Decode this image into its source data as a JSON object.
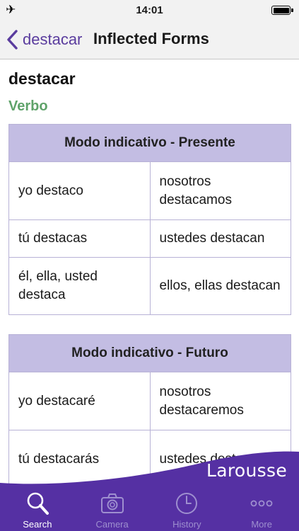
{
  "status_bar": {
    "time": "14:01",
    "airplane_icon": "airplane-icon",
    "battery_icon": "battery-icon"
  },
  "nav": {
    "back_label": "destacar",
    "title": "Inflected Forms"
  },
  "entry": {
    "word": "destacar",
    "part_of_speech": "Verbo"
  },
  "tables": [
    {
      "header": "Modo indicativo - Presente",
      "rows": [
        [
          "yo destaco",
          "nosotros destacamos"
        ],
        [
          "tú destacas",
          "ustedes destacan"
        ],
        [
          "él, ella, usted destaca",
          "ellos, ellas destacan"
        ]
      ]
    },
    {
      "header": "Modo indicativo - Futuro",
      "rows": [
        [
          "yo destacaré",
          "nosotros destacaremos"
        ],
        [
          "tú destacarás",
          "ustedes destacarán"
        ]
      ]
    }
  ],
  "brand": "Larousse",
  "tab_bar": {
    "active": "Search",
    "tabs": [
      {
        "label": "Search",
        "icon": "search-icon"
      },
      {
        "label": "Camera",
        "icon": "camera-icon"
      },
      {
        "label": "History",
        "icon": "clock-icon"
      },
      {
        "label": "More",
        "icon": "more-icon"
      }
    ]
  },
  "colors": {
    "accent": "#5a3c9e",
    "tab_bar": "#5530a3",
    "table_header": "#c3bde3",
    "part_of_speech": "#5fa36a"
  }
}
